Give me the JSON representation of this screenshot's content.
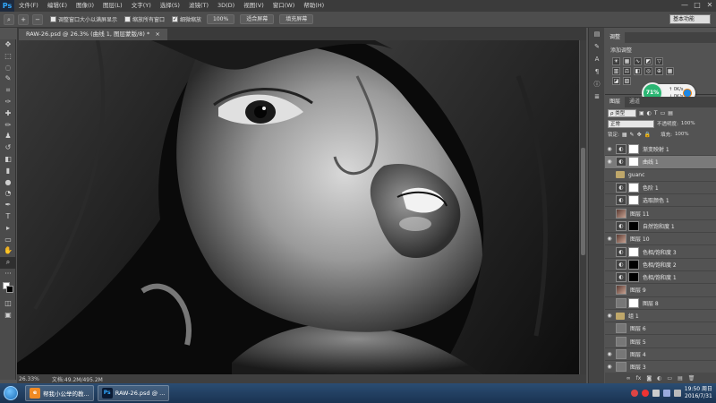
{
  "app": {
    "logo": "Ps",
    "menu": [
      "文件(F)",
      "编辑(E)",
      "图像(I)",
      "图层(L)",
      "文字(Y)",
      "选择(S)",
      "滤镜(T)",
      "3D(D)",
      "视图(V)",
      "窗口(W)",
      "帮助(H)"
    ],
    "window_controls": [
      "—",
      "□",
      "✕"
    ]
  },
  "options": {
    "check1": "调整窗口大小以满屏显示",
    "check2": "缩放所有窗口",
    "check3": "细微缩放",
    "btn_zoom": "100%",
    "btn_fit": "适合屏幕",
    "btn_fill": "填充屏幕",
    "workspace": "基本功能"
  },
  "document": {
    "tab_title": "RAW-26.psd @ 26.3% (曲线 1, 图层蒙版/8) *",
    "close": "×",
    "zoom": "26.33%",
    "doc_info": "文档:49.2M/495.2M"
  },
  "adjustments": {
    "tab1": "调整",
    "title": "添加调整"
  },
  "perf": {
    "percent": "71%",
    "up": "0K/s",
    "down": "0K/s"
  },
  "layers": {
    "tabs": [
      "图层",
      "通道"
    ],
    "filter_kind": "ρ 类型",
    "blend_mode": "正常",
    "opacity_label": "不透明度:",
    "opacity": "100%",
    "lock_label": "锁定:",
    "fill_label": "填充:",
    "fill": "100%",
    "items": [
      {
        "name": "渐变映射 1",
        "thumb": "adj",
        "mask": "mask",
        "visible": true,
        "selected": false
      },
      {
        "name": "曲线 1",
        "thumb": "adj",
        "mask": "mask",
        "visible": true,
        "selected": true
      },
      {
        "name": "guanc",
        "thumb": "folder",
        "mask": "",
        "visible": false,
        "selected": false
      },
      {
        "name": "色阶 1",
        "thumb": "adj",
        "mask": "mask",
        "visible": false,
        "selected": false
      },
      {
        "name": "选取颜色 1",
        "thumb": "adj",
        "mask": "mask",
        "visible": false,
        "selected": false
      },
      {
        "name": "图层 11",
        "thumb": "photo",
        "mask": "",
        "visible": false,
        "selected": false
      },
      {
        "name": "自然饱和度 1",
        "thumb": "adj",
        "mask": "black",
        "visible": false,
        "selected": false
      },
      {
        "name": "图层 10",
        "thumb": "photo",
        "mask": "",
        "visible": true,
        "selected": false
      },
      {
        "name": "色相/饱和度 3",
        "thumb": "adj",
        "mask": "mask",
        "visible": false,
        "selected": false
      },
      {
        "name": "色相/饱和度 2",
        "thumb": "adj",
        "mask": "black",
        "visible": false,
        "selected": false
      },
      {
        "name": "色相/饱和度 1",
        "thumb": "adj",
        "mask": "black",
        "visible": false,
        "selected": false
      },
      {
        "name": "图层 9",
        "thumb": "photo",
        "mask": "",
        "visible": false,
        "selected": false
      },
      {
        "name": "图层 8",
        "thumb": "gray",
        "mask": "mask",
        "visible": false,
        "selected": false
      },
      {
        "name": "组 1",
        "thumb": "folder",
        "mask": "",
        "visible": true,
        "selected": false
      },
      {
        "name": "图层 6",
        "thumb": "gray",
        "mask": "",
        "visible": false,
        "selected": false
      },
      {
        "name": "图层 5",
        "thumb": "gray",
        "mask": "",
        "visible": false,
        "selected": false
      },
      {
        "name": "图层 4",
        "thumb": "gray",
        "mask": "",
        "visible": true,
        "selected": false
      },
      {
        "name": "图层 3",
        "thumb": "gray",
        "mask": "",
        "visible": true,
        "selected": false
      }
    ],
    "footer": [
      "∞",
      "fx",
      "◙",
      "◐",
      "▭",
      "▤",
      "🗑"
    ]
  },
  "taskbar": {
    "task1": "帮我小公举的教...",
    "task2": "RAW-26.psd @ ...",
    "time": "19:50 周日",
    "date": "2016/7/31"
  }
}
